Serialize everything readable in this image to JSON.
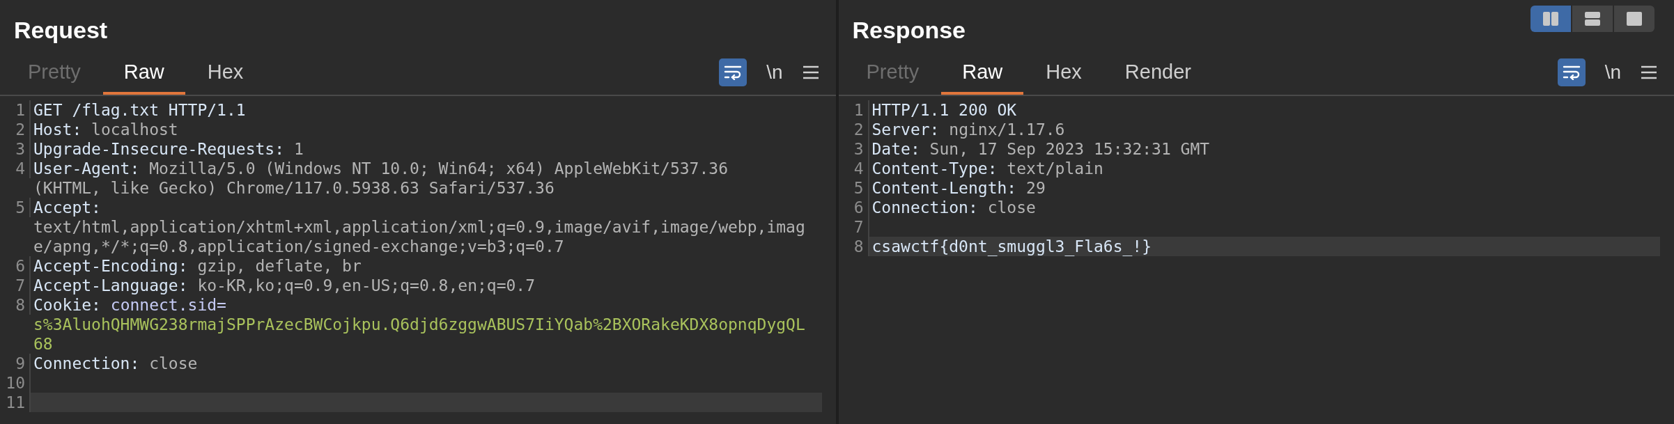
{
  "layout_buttons": [
    {
      "kind": "columns",
      "selected": true
    },
    {
      "kind": "rows",
      "selected": false
    },
    {
      "kind": "single",
      "selected": false
    }
  ],
  "panels": [
    {
      "title": "Request",
      "tabs": [
        {
          "label": "Pretty",
          "selected": false,
          "disabled": true
        },
        {
          "label": "Raw",
          "selected": true,
          "disabled": false
        },
        {
          "label": "Hex",
          "selected": false,
          "disabled": false
        }
      ],
      "wrap_on": true,
      "newline_toggle": "\\n",
      "lines": [
        {
          "number": "1",
          "highlighted": false,
          "segments": [
            {
              "kind": "key",
              "text": "GET /flag.txt HTTP/1.1"
            }
          ]
        },
        {
          "number": "2",
          "highlighted": false,
          "segments": [
            {
              "kind": "key",
              "text": "Host:"
            },
            {
              "kind": "value",
              "text": " localhost"
            }
          ]
        },
        {
          "number": "3",
          "highlighted": false,
          "segments": [
            {
              "kind": "key",
              "text": "Upgrade-Insecure-Requests:"
            },
            {
              "kind": "value",
              "text": " 1"
            }
          ]
        },
        {
          "number": "4",
          "highlighted": false,
          "segments": [
            {
              "kind": "key",
              "text": "User-Agent:"
            },
            {
              "kind": "value",
              "text": " Mozilla/5.0 (Windows NT 10.0; Win64; x64) AppleWebKit/537.36 (KHTML, like Gecko) Chrome/117.0.5938.63 Safari/537.36"
            }
          ]
        },
        {
          "number": "5",
          "highlighted": false,
          "segments": [
            {
              "kind": "key",
              "text": "Accept:"
            },
            {
              "kind": "value",
              "text": " text/html,application/xhtml+xml,application/xml;q=0.9,image/avif,image/webp,image/apng,*/*;q=0.8,application/signed-exchange;v=b3;q=0.7"
            }
          ]
        },
        {
          "number": "6",
          "highlighted": false,
          "segments": [
            {
              "kind": "key",
              "text": "Accept-Encoding:"
            },
            {
              "kind": "value",
              "text": " gzip, deflate, br"
            }
          ]
        },
        {
          "number": "7",
          "highlighted": false,
          "segments": [
            {
              "kind": "key",
              "text": "Accept-Language:"
            },
            {
              "kind": "value",
              "text": " ko-KR,ko;q=0.9,en-US;q=0.8,en;q=0.7"
            }
          ]
        },
        {
          "number": "8",
          "highlighted": false,
          "segments": [
            {
              "kind": "key",
              "text": "Cookie:"
            },
            {
              "kind": "cookie-name",
              "text": " connect.sid="
            },
            {
              "kind": "cookie-value",
              "text": "s%3AluohQHMWG238rmajSPPrAzecBWCojkpu.Q6djd6zggwABUS7IiYQab%2BXORakeKDX8opnqDygQL68"
            }
          ]
        },
        {
          "number": "9",
          "highlighted": false,
          "segments": [
            {
              "kind": "key",
              "text": "Connection:"
            },
            {
              "kind": "value",
              "text": " close"
            }
          ]
        },
        {
          "number": "10",
          "highlighted": false
        },
        {
          "number": "11",
          "highlighted": true
        }
      ]
    },
    {
      "title": "Response",
      "tabs": [
        {
          "label": "Pretty",
          "selected": false,
          "disabled": true
        },
        {
          "label": "Raw",
          "selected": true,
          "disabled": false
        },
        {
          "label": "Hex",
          "selected": false,
          "disabled": false
        },
        {
          "label": "Render",
          "selected": false,
          "disabled": false
        }
      ],
      "wrap_on": true,
      "newline_toggle": "\\n",
      "lines": [
        {
          "number": "1",
          "highlighted": false,
          "segments": [
            {
              "kind": "key",
              "text": "HTTP/1.1 200 OK"
            }
          ]
        },
        {
          "number": "2",
          "highlighted": false,
          "segments": [
            {
              "kind": "key",
              "text": "Server:"
            },
            {
              "kind": "value",
              "text": " nginx/1.17.6"
            }
          ]
        },
        {
          "number": "3",
          "highlighted": false,
          "segments": [
            {
              "kind": "key",
              "text": "Date:"
            },
            {
              "kind": "value",
              "text": " Sun, 17 Sep 2023 15:32:31 GMT"
            }
          ]
        },
        {
          "number": "4",
          "highlighted": false,
          "segments": [
            {
              "kind": "key",
              "text": "Content-Type:"
            },
            {
              "kind": "value",
              "text": " text/plain"
            }
          ]
        },
        {
          "number": "5",
          "highlighted": false,
          "segments": [
            {
              "kind": "key",
              "text": "Content-Length:"
            },
            {
              "kind": "value",
              "text": " 29"
            }
          ]
        },
        {
          "number": "6",
          "highlighted": false,
          "segments": [
            {
              "kind": "key",
              "text": "Connection:"
            },
            {
              "kind": "value",
              "text": " close"
            }
          ]
        },
        {
          "number": "7",
          "highlighted": false
        },
        {
          "number": "8",
          "highlighted": true,
          "segments": [
            {
              "kind": "key",
              "text": "csawctf{d0nt_smuggl3_Fla6s_!}"
            }
          ]
        }
      ]
    }
  ]
}
